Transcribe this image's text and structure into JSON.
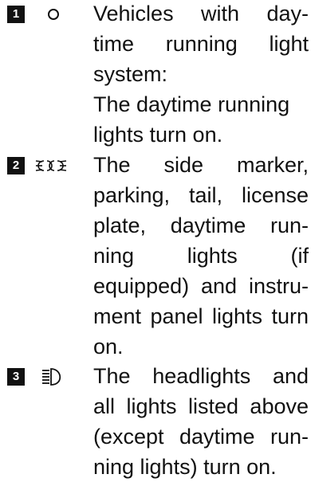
{
  "items": [
    {
      "number": "1",
      "symbol": "o-icon",
      "lines": [
        "Vehicles with day-",
        "time running light",
        "system:",
        "The daytime running",
        "lights turn on."
      ]
    },
    {
      "number": "2",
      "symbol": "side-marker-lights-icon",
      "lines": [
        "The side marker,",
        "parking, tail, license",
        "plate, daytime run-",
        "ning lights (if",
        "equipped) and instru-",
        "ment panel lights turn",
        "on."
      ]
    },
    {
      "number": "3",
      "symbol": "headlight-icon",
      "lines": [
        "The headlights and",
        "all lights listed above",
        "(except daytime run-",
        "ning lights) turn on."
      ]
    }
  ]
}
